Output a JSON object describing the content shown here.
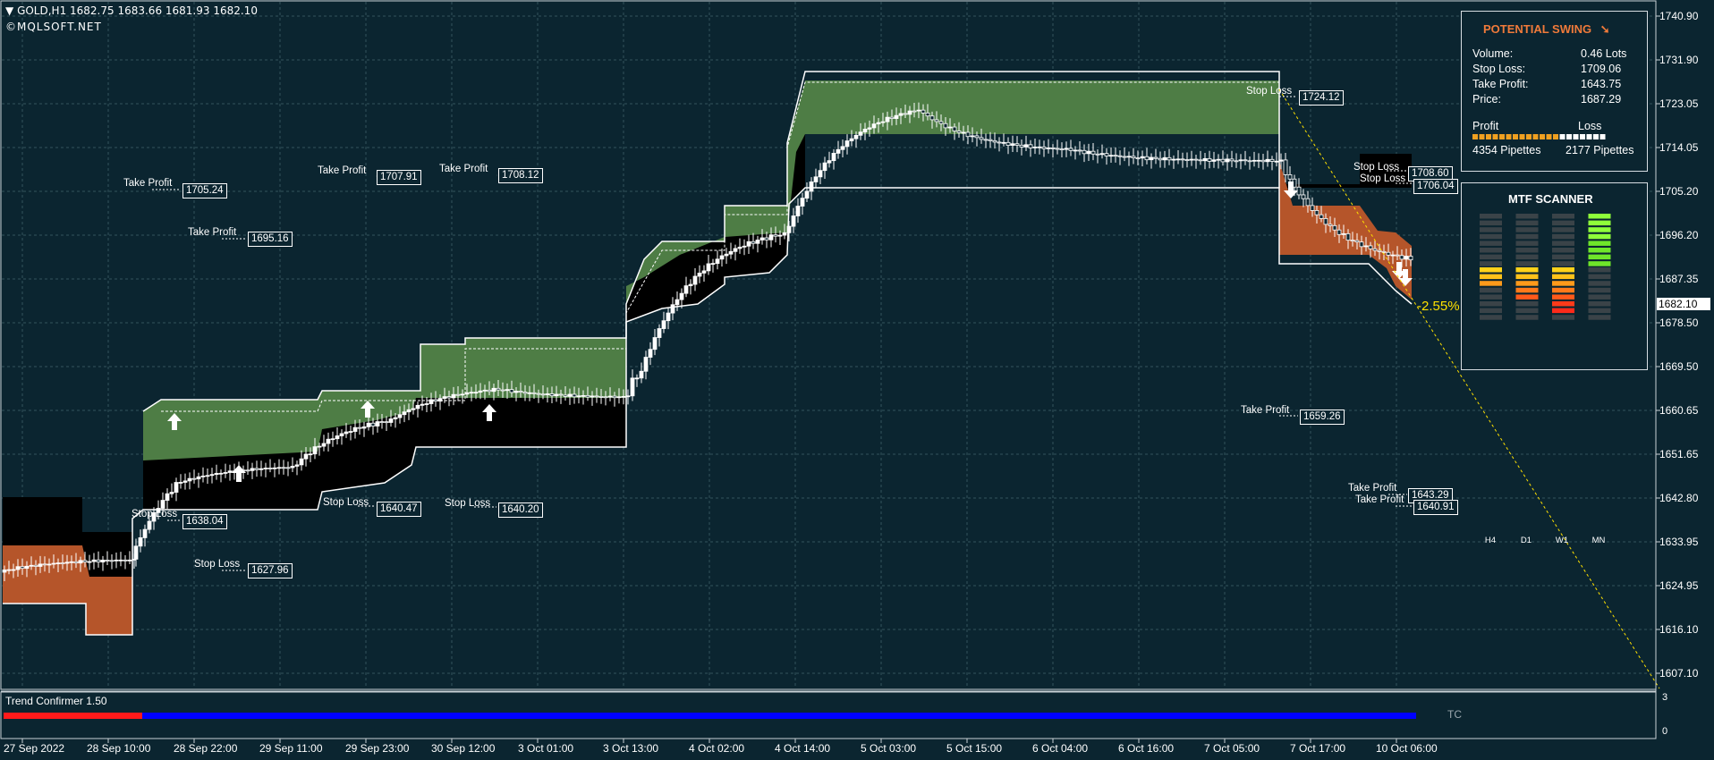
{
  "header": {
    "symbol_info": "GOLD,H1  1682.75 1683.66 1681.93 1682.10",
    "copyright": "©MQLSOFT.NET"
  },
  "price_axis": {
    "ticks": [
      "1740.90",
      "1731.90",
      "1723.05",
      "1714.05",
      "1705.20",
      "1696.20",
      "1687.35",
      "1678.50",
      "1669.50",
      "1660.65",
      "1651.65",
      "1642.80",
      "1633.95",
      "1624.95",
      "1616.10",
      "1607.10"
    ],
    "current_price": "1682.10"
  },
  "time_axis": {
    "ticks": [
      "27 Sep 2022",
      "28 Sep 10:00",
      "28 Sep 22:00",
      "29 Sep 11:00",
      "29 Sep 23:00",
      "30 Sep 12:00",
      "3 Oct 01:00",
      "3 Oct 13:00",
      "4 Oct 02:00",
      "4 Oct 14:00",
      "5 Oct 03:00",
      "5 Oct 15:00",
      "6 Oct 04:00",
      "6 Oct 16:00",
      "7 Oct 05:00",
      "7 Oct 17:00",
      "10 Oct 06:00"
    ]
  },
  "annotations": [
    {
      "label": "Take Profit",
      "value": "1705.24"
    },
    {
      "label": "Take Profit",
      "value": "1695.16"
    },
    {
      "label": "Take Profit",
      "value": "1707.91"
    },
    {
      "label": "Take Profit",
      "value": "1708.12"
    },
    {
      "label": "Stop Loss",
      "value": "1638.04"
    },
    {
      "label": "Stop Loss",
      "value": "1627.96"
    },
    {
      "label": "Stop Loss",
      "value": "1640.47"
    },
    {
      "label": "Stop Loss",
      "value": "1640.20"
    },
    {
      "label": "Stop Loss",
      "value": "1724.12"
    },
    {
      "label": "Stop Loss",
      "value": "1708.60"
    },
    {
      "label": "Stop Loss",
      "value": "1706.04"
    },
    {
      "label": "Take Profit",
      "value": "1659.26"
    },
    {
      "label": "Take Profit",
      "value": "1643.29"
    },
    {
      "label": "Take Profit",
      "value": "1640.91"
    }
  ],
  "projection_percent": "-2.55%",
  "potential_swing": {
    "title": "POTENTIAL SWING",
    "volume_label": "Volume:",
    "volume_value": "0.46 Lots",
    "stoploss_label": "Stop Loss:",
    "stoploss_value": "1709.06",
    "takeprofit_label": "Take Profit:",
    "takeprofit_value": "1643.75",
    "price_label": "Price:",
    "price_value": "1687.29",
    "profit_label": "Profit",
    "loss_label": "Loss",
    "profit_pipettes": "4354 Pipettes",
    "loss_pipettes": "2177 Pipettes",
    "profit_share": 0.67,
    "title_color": "#f07a3a"
  },
  "mtf_scanner": {
    "title": "MTF SCANNER",
    "timeframes": [
      {
        "name": "H4",
        "up_level": 0,
        "down_level": 3
      },
      {
        "name": "D1",
        "up_level": 0,
        "down_level": 5
      },
      {
        "name": "W1",
        "up_level": 0,
        "down_level": 7
      },
      {
        "name": "MN",
        "up_level": 8,
        "down_level": 0
      }
    ]
  },
  "indicator": {
    "name": "Trend Confirmer 1.50",
    "tag": "TC",
    "scale_max": "3",
    "scale_min": "0"
  }
}
